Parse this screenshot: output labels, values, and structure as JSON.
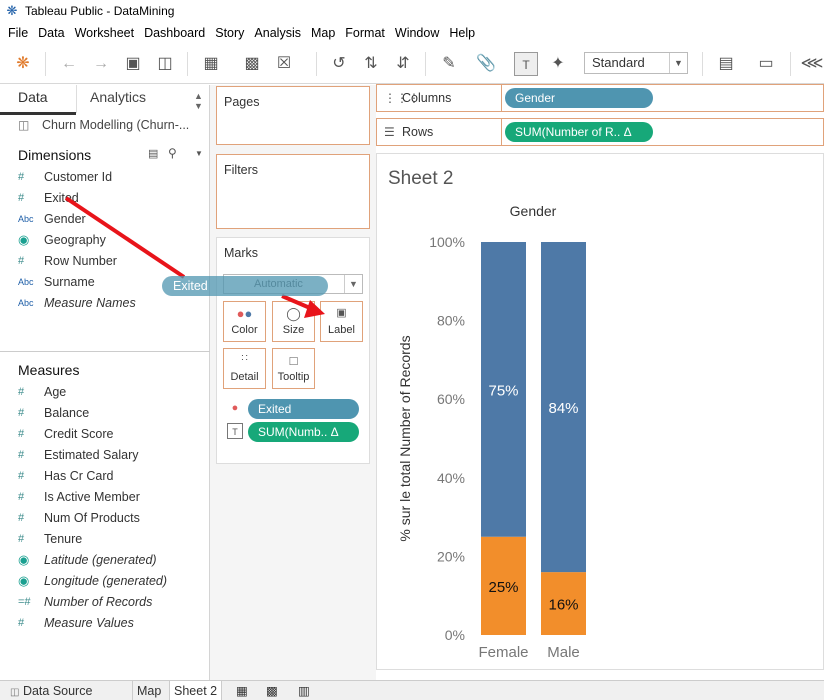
{
  "window": {
    "title": "Tableau Public - DataMining",
    "app_icon": "tableau-logo-icon"
  },
  "menu": [
    "File",
    "Data",
    "Worksheet",
    "Dashboard",
    "Story",
    "Analysis",
    "Map",
    "Format",
    "Window",
    "Help"
  ],
  "toolbar": {
    "view_size": "Standard"
  },
  "data_pane": {
    "tabs": [
      "Data",
      "Analytics"
    ],
    "datasource": "Churn Modelling (Churn-...",
    "dimensions_label": "Dimensions",
    "dimensions": [
      {
        "type": "number",
        "label": "Customer Id"
      },
      {
        "type": "number",
        "label": "Exited"
      },
      {
        "type": "text",
        "label": "Gender"
      },
      {
        "type": "geo",
        "label": "Geography"
      },
      {
        "type": "number",
        "label": "Row Number"
      },
      {
        "type": "text",
        "label": "Surname"
      },
      {
        "type": "text",
        "label": "Measure Names",
        "italic": true
      }
    ],
    "measures_label": "Measures",
    "measures": [
      {
        "type": "number",
        "label": "Age"
      },
      {
        "type": "number",
        "label": "Balance"
      },
      {
        "type": "number",
        "label": "Credit Score"
      },
      {
        "type": "number",
        "label": "Estimated Salary"
      },
      {
        "type": "number",
        "label": "Has Cr Card"
      },
      {
        "type": "number",
        "label": "Is Active Member"
      },
      {
        "type": "number",
        "label": "Num Of Products"
      },
      {
        "type": "number",
        "label": "Tenure"
      },
      {
        "type": "geo",
        "label": "Latitude (generated)",
        "italic": true
      },
      {
        "type": "geo",
        "label": "Longitude (generated)",
        "italic": true
      },
      {
        "type": "number",
        "label": "Number of Records",
        "italic": true
      },
      {
        "type": "number",
        "label": "Measure Values",
        "italic": true
      }
    ]
  },
  "cards": {
    "pages": "Pages",
    "filters": "Filters",
    "marks": "Marks",
    "mark_type": "Automatic",
    "buttons": {
      "color": "Color",
      "size": "Size",
      "label": "Label",
      "detail": "Detail",
      "tooltip": "Tooltip"
    },
    "pills": [
      "Exited",
      "SUM(Numb..  Δ"
    ]
  },
  "shelves": {
    "columns_label": "Columns",
    "columns_pill": "Gender",
    "rows_label": "Rows",
    "rows_pill": "SUM(Number of R..  Δ"
  },
  "drag": {
    "ghost_label": "Exited"
  },
  "sheet": {
    "title": "Sheet 2"
  },
  "bottom_tabs": [
    "Data Source",
    "Map",
    "Sheet 2"
  ],
  "colors": {
    "blue": "#4e79a7",
    "orange": "#f28e2b",
    "pill_blue": "#4f95b0",
    "pill_green": "#17a879",
    "accent": "#e0a27a"
  },
  "chart_data": {
    "type": "bar",
    "stacked": true,
    "header": "Gender",
    "ylabel": "% sur le total Number of Records",
    "categories": [
      "Female",
      "Male"
    ],
    "yticks": [
      "0%",
      "20%",
      "40%",
      "60%",
      "80%",
      "100%"
    ],
    "ylim": [
      0,
      100
    ],
    "series": [
      {
        "values": [
          25,
          16
        ],
        "labels": [
          "25%",
          "16%"
        ],
        "color": "#f28e2b"
      },
      {
        "values": [
          75,
          84
        ],
        "labels": [
          "75%",
          "84%"
        ],
        "color": "#4e79a7"
      }
    ]
  }
}
